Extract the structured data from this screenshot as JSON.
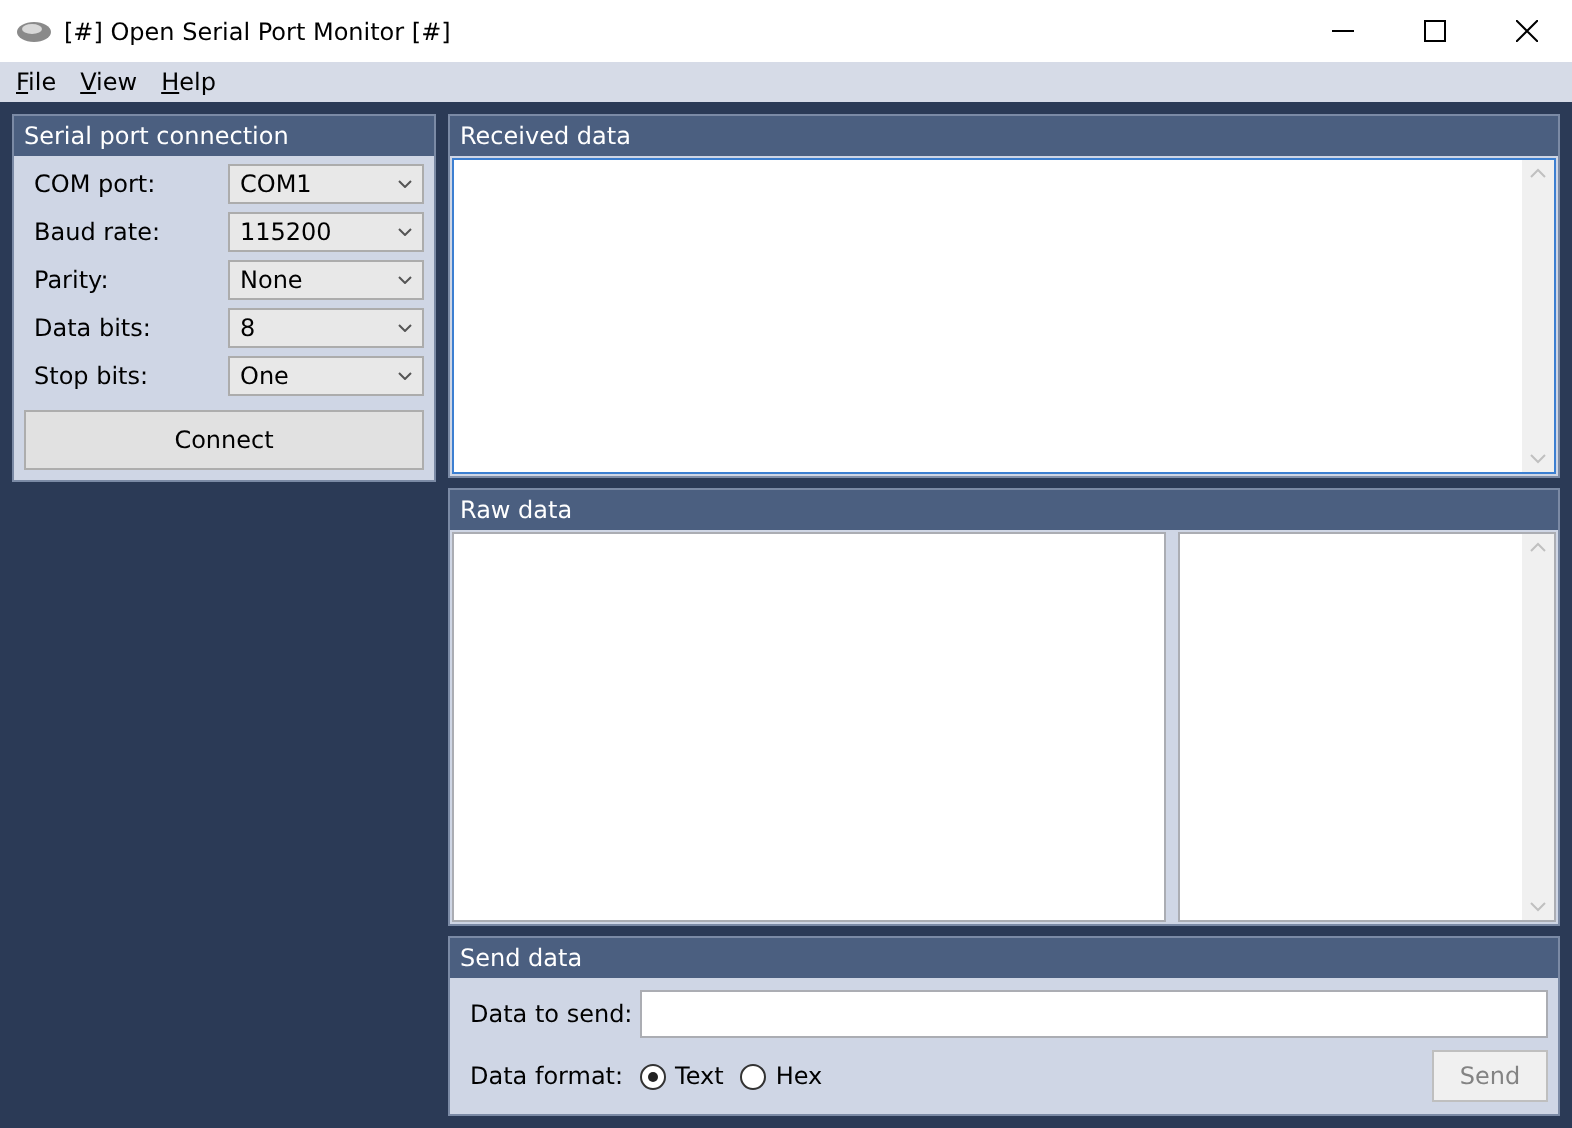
{
  "window": {
    "title": "[#] Open Serial Port Monitor [#]"
  },
  "menu": [
    "File",
    "View",
    "Help"
  ],
  "connection": {
    "title": "Serial port connection",
    "fields": [
      {
        "label": "COM port:",
        "value": "COM1"
      },
      {
        "label": "Baud rate:",
        "value": "115200"
      },
      {
        "label": "Parity:",
        "value": "None"
      },
      {
        "label": "Data bits:",
        "value": "8"
      },
      {
        "label": "Stop bits:",
        "value": "One"
      }
    ],
    "button": "Connect"
  },
  "received": {
    "title": "Received data",
    "focused": true
  },
  "raw": {
    "title": "Raw data"
  },
  "send": {
    "title": "Send data",
    "label": "Data to send:",
    "format_label": "Data format:",
    "formats": [
      {
        "label": "Text",
        "selected": true
      },
      {
        "label": "Hex",
        "selected": false
      }
    ],
    "button": {
      "label": "Send",
      "disabled": true
    }
  }
}
